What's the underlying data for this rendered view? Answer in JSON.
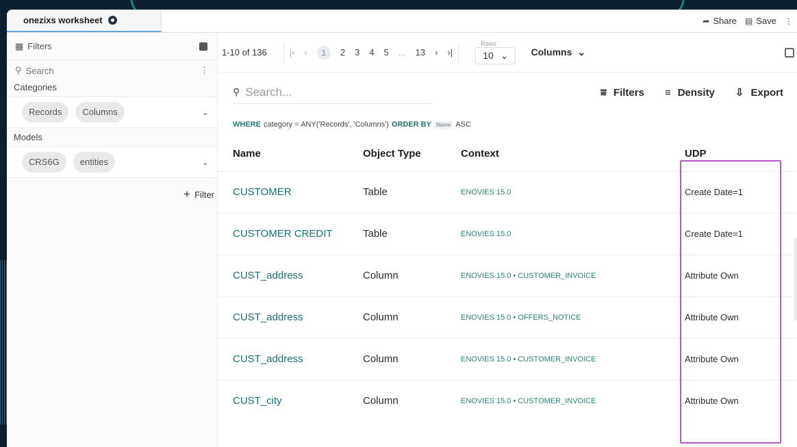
{
  "window": {
    "tab_title": "onezixs worksheet",
    "actions": [
      {
        "label": "Share",
        "icon": "share-icon"
      },
      {
        "label": "Save",
        "icon": "save-icon"
      }
    ]
  },
  "sidebar": {
    "header": "Filters",
    "search_placeholder": "Search",
    "sections": [
      {
        "label": "Categories",
        "chips": [
          "Records",
          "Columns"
        ]
      },
      {
        "label": "Models",
        "chips": [
          "CRS6G",
          "entities"
        ]
      }
    ],
    "add_filter": "Filter"
  },
  "pager": {
    "count": "1-10 of 136",
    "current_page": "1",
    "pages": [
      "2",
      "3",
      "4",
      "5",
      "...",
      "13"
    ],
    "rows_label": "Rows",
    "rows_value": "10",
    "columns_label": "Columns"
  },
  "toolbar": {
    "search_placeholder": "Search...",
    "filters": "Filters",
    "density": "Density",
    "export": "Export"
  },
  "query": {
    "kw_where": "WHERE",
    "clause": "category = ANY('Records', 'Columns')",
    "kw_order": "ORDER BY",
    "field": "Name",
    "dir": "ASC"
  },
  "table": {
    "headers": [
      "Name",
      "Object Type",
      "Context",
      "UDP"
    ],
    "rows": [
      {
        "name": "CUSTOMER",
        "type": "Table",
        "context": "ENOVIES 15.0",
        "udp": "Create Date=1"
      },
      {
        "name": "CUSTOMER CREDIT",
        "type": "Table",
        "context": "ENOVIES 15.0",
        "udp": "Create Date=1"
      },
      {
        "name": "CUST_address",
        "type": "Column",
        "context": "ENOVIES 15.0 • CUSTOMER_INVOICE",
        "udp": "Attribute Own"
      },
      {
        "name": "CUST_address",
        "type": "Column",
        "context": "ENOVIES 15.0 • OFFERS_NOTICE",
        "udp": "Attribute Own"
      },
      {
        "name": "CUST_address",
        "type": "Column",
        "context": "ENOVIES 15.0 • CUSTOMER_INVOICE",
        "udp": "Attribute Own"
      },
      {
        "name": "CUST_city",
        "type": "Column",
        "context": "ENOVIES 15.0 • CUSTOMER_INVOICE",
        "udp": "Attribute Own"
      }
    ]
  },
  "colors": {
    "accent": "#1d6f73",
    "highlight": "#b45cc5",
    "background": "#0b1f2e"
  }
}
